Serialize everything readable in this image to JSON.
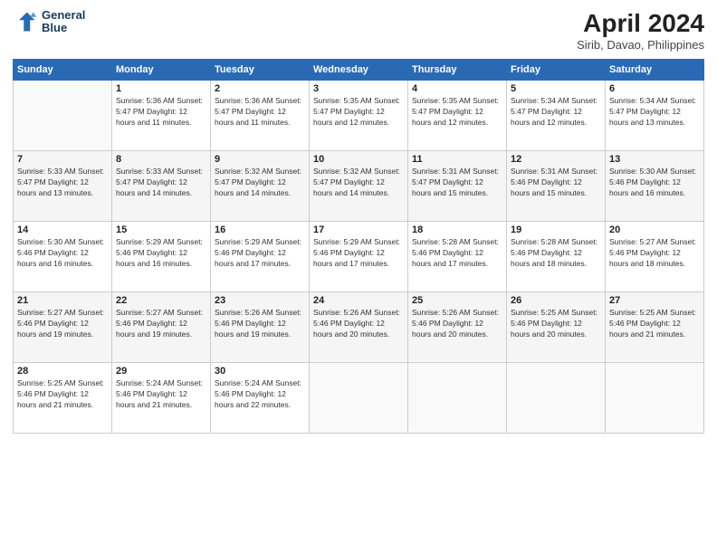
{
  "header": {
    "logo_line1": "General",
    "logo_line2": "Blue",
    "title": "April 2024",
    "subtitle": "Sirib, Davao, Philippines"
  },
  "days_of_week": [
    "Sunday",
    "Monday",
    "Tuesday",
    "Wednesday",
    "Thursday",
    "Friday",
    "Saturday"
  ],
  "weeks": [
    [
      {
        "day": "",
        "info": ""
      },
      {
        "day": "1",
        "info": "Sunrise: 5:36 AM\nSunset: 5:47 PM\nDaylight: 12 hours\nand 11 minutes."
      },
      {
        "day": "2",
        "info": "Sunrise: 5:36 AM\nSunset: 5:47 PM\nDaylight: 12 hours\nand 11 minutes."
      },
      {
        "day": "3",
        "info": "Sunrise: 5:35 AM\nSunset: 5:47 PM\nDaylight: 12 hours\nand 12 minutes."
      },
      {
        "day": "4",
        "info": "Sunrise: 5:35 AM\nSunset: 5:47 PM\nDaylight: 12 hours\nand 12 minutes."
      },
      {
        "day": "5",
        "info": "Sunrise: 5:34 AM\nSunset: 5:47 PM\nDaylight: 12 hours\nand 12 minutes."
      },
      {
        "day": "6",
        "info": "Sunrise: 5:34 AM\nSunset: 5:47 PM\nDaylight: 12 hours\nand 13 minutes."
      }
    ],
    [
      {
        "day": "7",
        "info": "Sunrise: 5:33 AM\nSunset: 5:47 PM\nDaylight: 12 hours\nand 13 minutes."
      },
      {
        "day": "8",
        "info": "Sunrise: 5:33 AM\nSunset: 5:47 PM\nDaylight: 12 hours\nand 14 minutes."
      },
      {
        "day": "9",
        "info": "Sunrise: 5:32 AM\nSunset: 5:47 PM\nDaylight: 12 hours\nand 14 minutes."
      },
      {
        "day": "10",
        "info": "Sunrise: 5:32 AM\nSunset: 5:47 PM\nDaylight: 12 hours\nand 14 minutes."
      },
      {
        "day": "11",
        "info": "Sunrise: 5:31 AM\nSunset: 5:47 PM\nDaylight: 12 hours\nand 15 minutes."
      },
      {
        "day": "12",
        "info": "Sunrise: 5:31 AM\nSunset: 5:46 PM\nDaylight: 12 hours\nand 15 minutes."
      },
      {
        "day": "13",
        "info": "Sunrise: 5:30 AM\nSunset: 5:46 PM\nDaylight: 12 hours\nand 16 minutes."
      }
    ],
    [
      {
        "day": "14",
        "info": "Sunrise: 5:30 AM\nSunset: 5:46 PM\nDaylight: 12 hours\nand 16 minutes."
      },
      {
        "day": "15",
        "info": "Sunrise: 5:29 AM\nSunset: 5:46 PM\nDaylight: 12 hours\nand 16 minutes."
      },
      {
        "day": "16",
        "info": "Sunrise: 5:29 AM\nSunset: 5:46 PM\nDaylight: 12 hours\nand 17 minutes."
      },
      {
        "day": "17",
        "info": "Sunrise: 5:29 AM\nSunset: 5:46 PM\nDaylight: 12 hours\nand 17 minutes."
      },
      {
        "day": "18",
        "info": "Sunrise: 5:28 AM\nSunset: 5:46 PM\nDaylight: 12 hours\nand 17 minutes."
      },
      {
        "day": "19",
        "info": "Sunrise: 5:28 AM\nSunset: 5:46 PM\nDaylight: 12 hours\nand 18 minutes."
      },
      {
        "day": "20",
        "info": "Sunrise: 5:27 AM\nSunset: 5:46 PM\nDaylight: 12 hours\nand 18 minutes."
      }
    ],
    [
      {
        "day": "21",
        "info": "Sunrise: 5:27 AM\nSunset: 5:46 PM\nDaylight: 12 hours\nand 19 minutes."
      },
      {
        "day": "22",
        "info": "Sunrise: 5:27 AM\nSunset: 5:46 PM\nDaylight: 12 hours\nand 19 minutes."
      },
      {
        "day": "23",
        "info": "Sunrise: 5:26 AM\nSunset: 5:46 PM\nDaylight: 12 hours\nand 19 minutes."
      },
      {
        "day": "24",
        "info": "Sunrise: 5:26 AM\nSunset: 5:46 PM\nDaylight: 12 hours\nand 20 minutes."
      },
      {
        "day": "25",
        "info": "Sunrise: 5:26 AM\nSunset: 5:46 PM\nDaylight: 12 hours\nand 20 minutes."
      },
      {
        "day": "26",
        "info": "Sunrise: 5:25 AM\nSunset: 5:46 PM\nDaylight: 12 hours\nand 20 minutes."
      },
      {
        "day": "27",
        "info": "Sunrise: 5:25 AM\nSunset: 5:46 PM\nDaylight: 12 hours\nand 21 minutes."
      }
    ],
    [
      {
        "day": "28",
        "info": "Sunrise: 5:25 AM\nSunset: 5:46 PM\nDaylight: 12 hours\nand 21 minutes."
      },
      {
        "day": "29",
        "info": "Sunrise: 5:24 AM\nSunset: 5:46 PM\nDaylight: 12 hours\nand 21 minutes."
      },
      {
        "day": "30",
        "info": "Sunrise: 5:24 AM\nSunset: 5:46 PM\nDaylight: 12 hours\nand 22 minutes."
      },
      {
        "day": "",
        "info": ""
      },
      {
        "day": "",
        "info": ""
      },
      {
        "day": "",
        "info": ""
      },
      {
        "day": "",
        "info": ""
      }
    ]
  ]
}
